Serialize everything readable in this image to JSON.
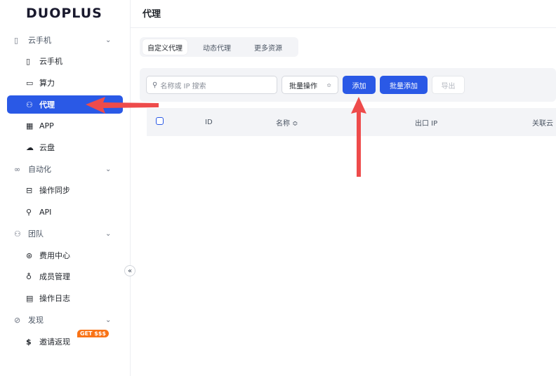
{
  "brand": {
    "logo_text": "DUOPLUS"
  },
  "header": {
    "title": "代理"
  },
  "sidebar": {
    "groups": [
      {
        "label": "云手机",
        "icon": "phone-outline-icon"
      },
      {
        "label": "自动化",
        "icon": "infinity-icon"
      },
      {
        "label": "团队",
        "icon": "team-icon"
      },
      {
        "label": "发现",
        "icon": "compass-icon"
      }
    ],
    "items": [
      {
        "label": "云手机",
        "icon": "phone-icon"
      },
      {
        "label": "算力",
        "icon": "monitor-icon"
      },
      {
        "label": "代理",
        "icon": "proxy-icon",
        "active": true
      },
      {
        "label": "APP",
        "icon": "grid-icon"
      },
      {
        "label": "云盘",
        "icon": "cloud-icon"
      },
      {
        "label": "操作同步",
        "icon": "sync-icon"
      },
      {
        "label": "API",
        "icon": "api-icon"
      },
      {
        "label": "费用中心",
        "icon": "dollar-circle-icon"
      },
      {
        "label": "成员管理",
        "icon": "member-icon"
      },
      {
        "label": "操作日志",
        "icon": "log-icon"
      },
      {
        "label": "邀请返现",
        "icon": "dollar-icon",
        "badge": "GET $$$"
      }
    ],
    "collapse_label": "«"
  },
  "tabs": [
    {
      "label": "自定义代理",
      "active": true
    },
    {
      "label": "动态代理",
      "active": false
    },
    {
      "label": "更多资源",
      "active": false
    }
  ],
  "toolbar": {
    "search_placeholder": "名称或 IP 搜索",
    "batch_label": "批量操作",
    "add_label": "添加",
    "batch_add_label": "批量添加",
    "export_label": "导出"
  },
  "table": {
    "columns": [
      "ID",
      "名称 ≎",
      "出口 IP",
      "关联云"
    ]
  },
  "colors": {
    "accent": "#2a59e6",
    "arrow": "#ee4b4b",
    "badge": "#f97316"
  }
}
